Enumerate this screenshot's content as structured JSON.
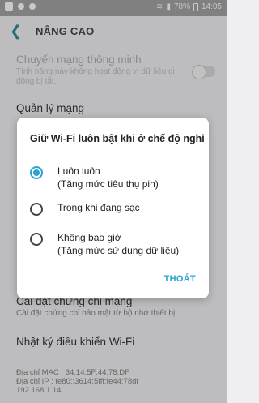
{
  "status_bar": {
    "battery": "78%",
    "time": "14:05"
  },
  "header": {
    "title": "NÂNG CAO"
  },
  "settings": {
    "smart_switch": {
      "title": "Chuyển mạng thông minh",
      "subtitle": "Tính năng này không hoạt động vì dữ liệu di động bị tắt."
    },
    "network_manage": {
      "title": "Quản lý mạng"
    },
    "cert_install": {
      "title": "Cài đặt chứng chỉ mạng",
      "subtitle": "Cài đặt chứng chỉ bảo mật từ bộ nhớ thiết bị."
    },
    "wifi_log": {
      "title": "Nhật ký điều khiển Wi-Fi"
    },
    "mac_address": "Địa chỉ MAC : 34:14:5F:44:78:DF",
    "ip_address": "Địa chỉ IP : fe80::3614:5fff:fe44:78df",
    "ip4_address": "192.168.1.14"
  },
  "dialog": {
    "title": "Giữ Wi-Fi luôn bật khi ở chế độ nghỉ",
    "options": [
      {
        "line1": "Luôn luôn",
        "line2": "(Tăng mức tiêu thụ pin)",
        "selected": true
      },
      {
        "line1": "Trong khi đang sạc",
        "line2": "",
        "selected": false
      },
      {
        "line1": "Không bao giờ",
        "line2": "(Tăng mức sử dụng dữ liệu)",
        "selected": false
      }
    ],
    "exit_label": "THOÁT"
  },
  "colors": {
    "accent": "#2ba3d3",
    "back_arrow": "#1e7f90"
  }
}
